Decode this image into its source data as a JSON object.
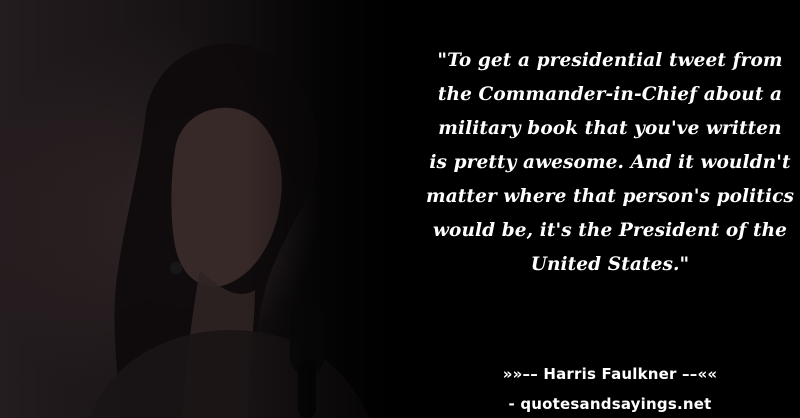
{
  "quote": {
    "lines": [
      "\"To get a presidential tweet from",
      "the Commander-in-Chief about a",
      "military book that you've written",
      "is pretty awesome. And it wouldn't",
      "matter where that person's politics",
      "would be, it's the President of the",
      "United States.\""
    ]
  },
  "author_line": "»»–– Harris Faulkner ––««",
  "source_line": "- quotesandsayings.net",
  "colors": {
    "background": "#000000",
    "text": "#ffffff"
  }
}
